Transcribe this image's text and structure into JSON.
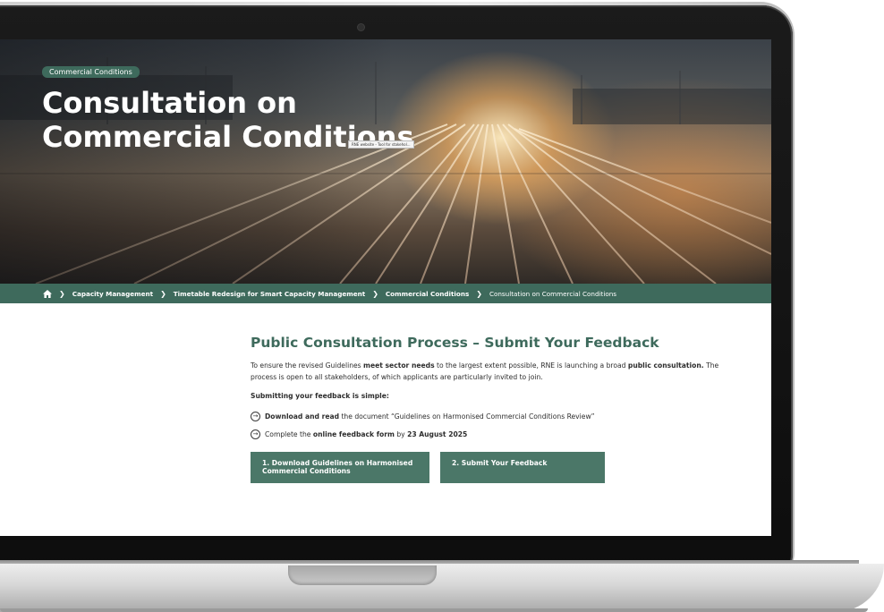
{
  "hero": {
    "category_tag": "Commercial Conditions",
    "title": "Consultation on Commercial Conditions",
    "tooltip": "RNE website - Tool for stakehol..."
  },
  "breadcrumb": {
    "home_icon": "home-icon",
    "separator_icon": "chevron-right-icon",
    "items": [
      "Capacity Management",
      "Timetable Redesign for Smart Capacity Management",
      "Commercial Conditions"
    ],
    "current": "Consultation on Commercial Conditions"
  },
  "section": {
    "title": "Public Consultation Process – Submit Your Feedback",
    "intro": {
      "part1": "To ensure the revised Guidelines ",
      "bold1": "meet sector needs",
      "part2": " to the largest extent possible, RNE is launching a broad ",
      "bold2": "public consultation.",
      "part3": " The process is open to all stakeholders, of which applicants are particularly invited to join."
    },
    "steps_intro": "Submitting your feedback is simple:",
    "steps": [
      {
        "icon": "arrow-circle-right-icon",
        "bold": "Download and read",
        "text": " the document “Guidelines on Harmonised Commercial Conditions Review”"
      },
      {
        "icon": "arrow-circle-right-icon",
        "text_before": "Complete the ",
        "bold": "online feedback form",
        "text_after": " by ",
        "bold2": "23 August 2025"
      }
    ],
    "buttons": {
      "download": "1. Download Guidelines on Harmonised Commercial Conditions",
      "feedback": "2. Submit Your Feedback"
    }
  },
  "colors": {
    "accent": "#3e6a5c",
    "button": "#4b7768",
    "text": "#2d2d2d"
  }
}
